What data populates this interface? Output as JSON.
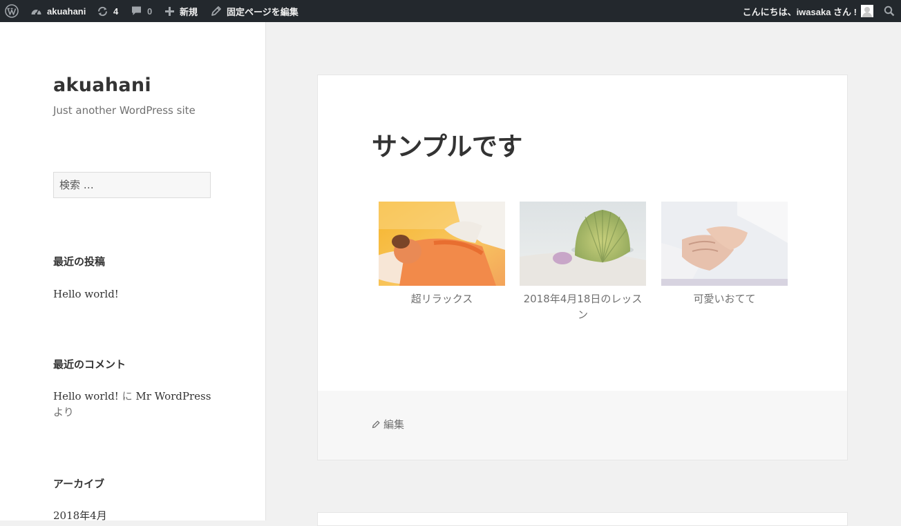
{
  "adminbar": {
    "site_name": "akuahani",
    "updates_count": "4",
    "comments_count": "0",
    "new_label": "新規",
    "edit_page_label": "固定ページを編集",
    "greeting": "こんにちは、iwasaka さん !",
    "icons": [
      "wordpress-logo-icon",
      "dashboard-icon",
      "refresh-icon",
      "comment-icon",
      "plus-icon",
      "pencil-icon",
      "search-icon"
    ]
  },
  "sidebar": {
    "site_title": "akuahani",
    "site_description": "Just another WordPress site",
    "search_placeholder": "検索 …",
    "recent_posts": {
      "title": "最近の投稿",
      "items": [
        "Hello world!"
      ]
    },
    "recent_comments": {
      "title": "最近のコメント",
      "post_link": "Hello world!",
      "connector": "に",
      "author": "Mr WordPress",
      "suffix": "より"
    },
    "archives": {
      "title": "アーカイブ",
      "items": [
        "2018年4月"
      ]
    }
  },
  "article": {
    "title": "サンプルです",
    "gallery": [
      {
        "caption": "超リラックス",
        "image": "massage-photo"
      },
      {
        "caption": "2018年4月18日のレッスン",
        "image": "seashell-photo"
      },
      {
        "caption": "可愛いおてて",
        "image": "hands-photo"
      }
    ],
    "edit_label": "編集"
  },
  "colors": {
    "adminbar_bg": "#23282d",
    "page_bg": "#f1f1f1",
    "card_bg": "#ffffff",
    "footer_bg": "#f7f7f7",
    "text": "#333333",
    "muted_text": "#707070"
  }
}
